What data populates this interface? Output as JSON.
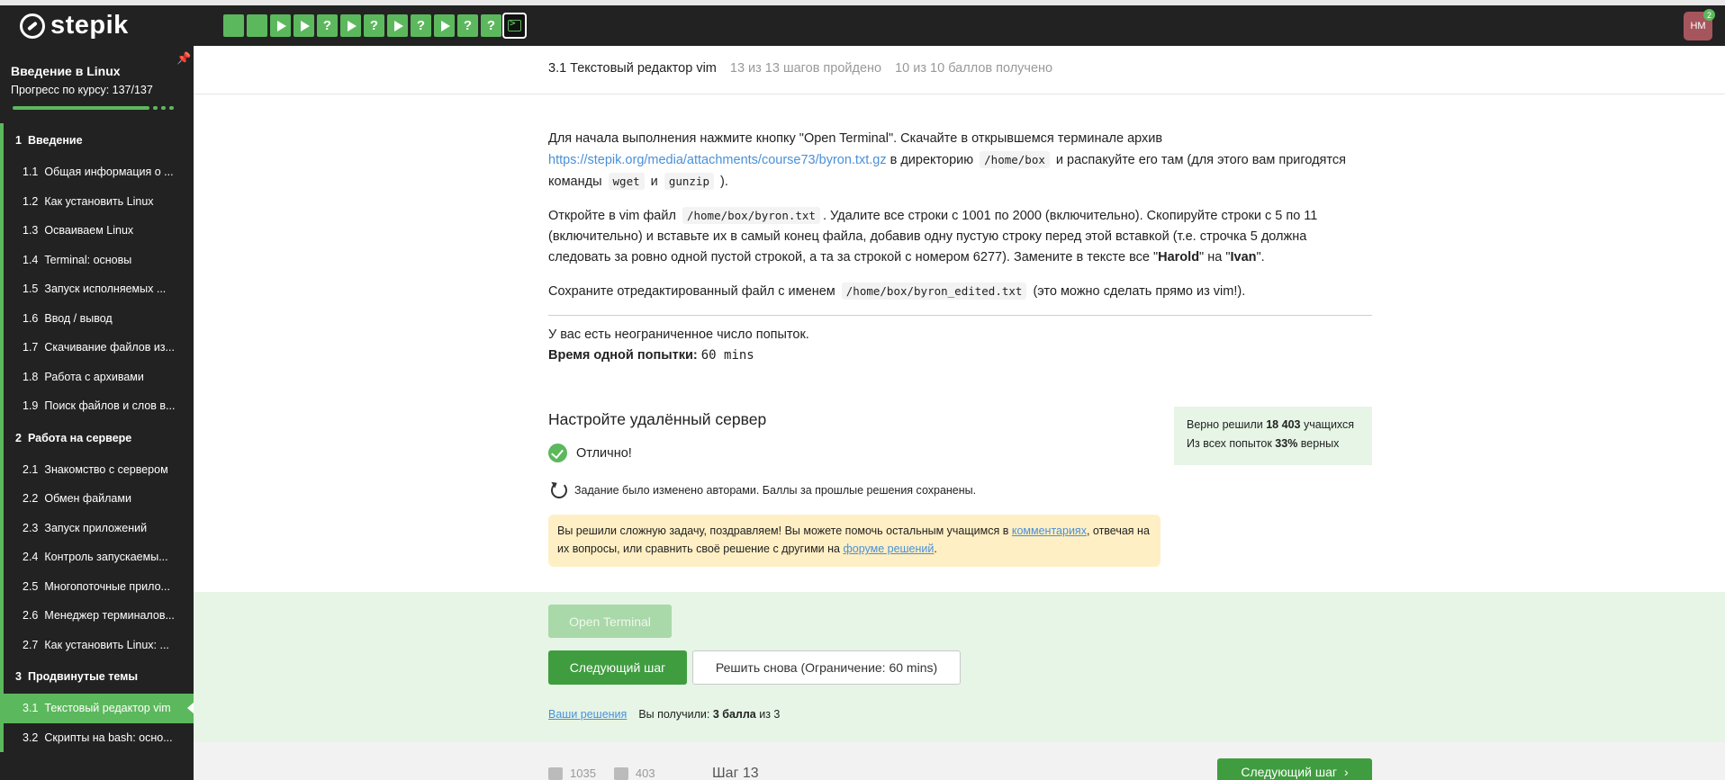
{
  "brand": {
    "name": "stepik"
  },
  "step_nav": [
    "square",
    "square",
    "play",
    "play",
    "question",
    "play",
    "question",
    "play",
    "question",
    "play",
    "question",
    "question",
    "terminal"
  ],
  "user": {
    "initials": "НМ",
    "badge": "2"
  },
  "sidebar": {
    "course_title": "Введение в Linux",
    "progress_text": "Прогресс по курсу:  137/137",
    "sections": [
      {
        "num": "1",
        "title": "Введение",
        "items": [
          {
            "num": "1.1",
            "label": "Общая информация о ..."
          },
          {
            "num": "1.2",
            "label": "Как установить Linux"
          },
          {
            "num": "1.3",
            "label": "Осваиваем Linux"
          },
          {
            "num": "1.4",
            "label": "Terminal: основы"
          },
          {
            "num": "1.5",
            "label": "Запуск исполняемых ..."
          },
          {
            "num": "1.6",
            "label": "Ввод / вывод"
          },
          {
            "num": "1.7",
            "label": "Скачивание файлов из..."
          },
          {
            "num": "1.8",
            "label": "Работа с архивами"
          },
          {
            "num": "1.9",
            "label": "Поиск файлов и слов в..."
          }
        ]
      },
      {
        "num": "2",
        "title": "Работа на сервере",
        "items": [
          {
            "num": "2.1",
            "label": "Знакомство с сервером"
          },
          {
            "num": "2.2",
            "label": "Обмен файлами"
          },
          {
            "num": "2.3",
            "label": "Запуск приложений"
          },
          {
            "num": "2.4",
            "label": "Контроль запускаемы..."
          },
          {
            "num": "2.5",
            "label": "Многопоточные прило..."
          },
          {
            "num": "2.6",
            "label": "Менеджер терминалов..."
          },
          {
            "num": "2.7",
            "label": "Как установить Linux: ..."
          }
        ]
      },
      {
        "num": "3",
        "title": "Продвинутые темы",
        "items": [
          {
            "num": "3.1",
            "label": "Текстовый редактор vim",
            "active": true
          },
          {
            "num": "3.2",
            "label": "Скрипты на bash: осно..."
          }
        ]
      }
    ]
  },
  "header": {
    "lesson": "3.1 Текстовый редактор vim",
    "steps_done": "13 из 13 шагов пройдено",
    "score": "10 из 10 баллов  получено"
  },
  "task": {
    "p1_a": "Для начала выполнения нажмите кнопку \"Open Terminal\". Скачайте в открывшемся терминале архив ",
    "p1_link": "https://stepik.org/media/attachments/course73/byron.txt.gz",
    "p1_b": " в директорию ",
    "p1_code1": "/home/box",
    "p1_c": " и распакуйте его там (для этого вам пригодятся команды ",
    "p1_code2": "wget",
    "p1_d": " и ",
    "p1_code3": "gunzip",
    "p1_e": " ).",
    "p2_a": "Откройте в vim файл ",
    "p2_code": "/home/box/byron.txt",
    "p2_b": ". Удалите все строки с 1001 по 2000 (включительно). Скопируйте строки с 5 по 11 (включительно) и вставьте их в самый конец файла, добавив одну пустую строку перед этой вставкой (т.е. строчка 5 должна следовать за ровно одной пустой строкой, а та за строкой с номером 6277). Замените в тексте все \"",
    "p2_bold1": "Harold",
    "p2_c": "\" на \"",
    "p2_bold2": "Ivan",
    "p2_d": "\".",
    "p3_a": "Сохраните отредактированный файл с именем ",
    "p3_code": "/home/box/byron_edited.txt",
    "p3_b": " (это можно сделать прямо из vim!).",
    "attempts": "У вас есть неограниченное число попыток.",
    "time_label": "Время одной попытки:",
    "time_value": "60 mins"
  },
  "result": {
    "title": "Настройте удалённый сервер",
    "status": "Отлично!",
    "changed": "Задание было изменено авторами. Баллы за прошлые решения сохранены.",
    "stats_a": "Верно решили ",
    "stats_count": "18 403",
    "stats_b": " учащихся",
    "stats_c": "Из всех попыток ",
    "stats_pct": "33%",
    "stats_d": " верных",
    "congrats_a": "Вы решили сложную задачу, поздравляем! Вы можете помочь остальным учащимся в ",
    "congrats_link1": "комментариях",
    "congrats_b": ", отвечая на их вопросы, или сравнить своё решение с другими на ",
    "congrats_link2": "форуме решений",
    "congrats_c": "."
  },
  "actions": {
    "open_terminal": "Open Terminal",
    "next_step": "Следующий шаг",
    "retry": "Решить снова (Ограничение: 60 mins)",
    "your_solutions": "Ваши решения",
    "got_a": "Вы получили: ",
    "got_bold": "3 балла",
    "got_b": " из 3"
  },
  "footer": {
    "likes": "1035",
    "dislikes": "403",
    "step": "Шаг 13",
    "next_step": "Следующий шаг"
  },
  "colors": {
    "accent": "#5cb85c",
    "dark": "#222222",
    "link": "#4a90d9",
    "success_bg": "#e6f5e6",
    "warning_bg": "#ffefc4"
  }
}
